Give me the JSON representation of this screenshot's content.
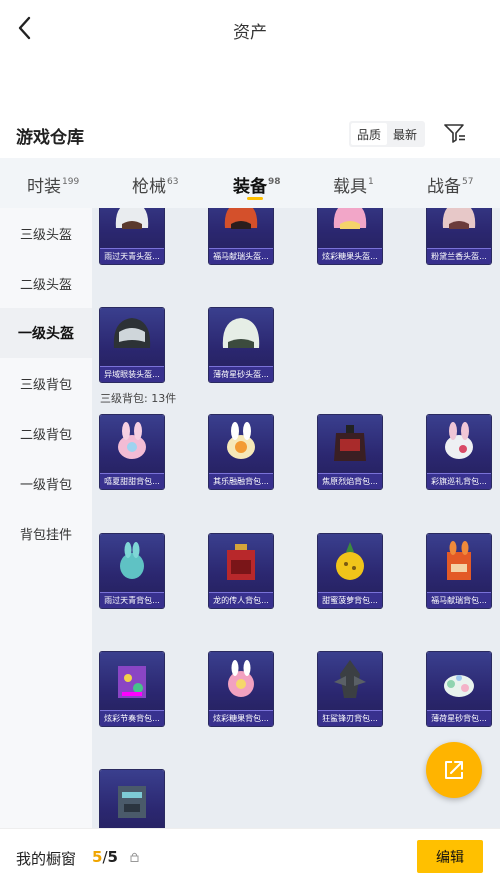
{
  "header": {
    "title": "资产"
  },
  "section": {
    "title": "游戏仓库",
    "sort_options": [
      "品质",
      "最新"
    ]
  },
  "tabs": [
    {
      "label": "时装",
      "count": "199"
    },
    {
      "label": "枪械",
      "count": "63"
    },
    {
      "label": "装备",
      "count": "98"
    },
    {
      "label": "载具",
      "count": "1"
    },
    {
      "label": "战备",
      "count": "57"
    }
  ],
  "sidebar": [
    "三级头盔",
    "二级头盔",
    "一级头盔",
    "三级背包",
    "二级背包",
    "一级背包",
    "背包挂件"
  ],
  "helmets": [
    "雨过天青头盔...",
    "福马献瑞头盔...",
    "炫彩糖果头盔...",
    "粉黛兰香头盔...",
    "异域眼装头盔...",
    "薄荷星砂头盔..."
  ],
  "group_backpack": {
    "header": "三级背包: 13件"
  },
  "backpacks": [
    "嘻夏甜甜背包...",
    "其乐融融背包...",
    "焦原烈焰背包...",
    "彩旗巡礼背包...",
    "雨过天青背包...",
    "龙的传人背包...",
    "甜蜜菠萝背包...",
    "福马献瑞背包...",
    "炫彩节奏背包...",
    "炫彩糖果背包...",
    "狂鲨锋刃背包...",
    "薄荷星砂背包...",
    ""
  ],
  "bottom": {
    "label": "我的橱窗",
    "used": "5",
    "sep": "/",
    "total": "5",
    "edit": "编辑"
  },
  "colors": {
    "accent": "#ffc000",
    "card_bg": "#2b2770"
  }
}
